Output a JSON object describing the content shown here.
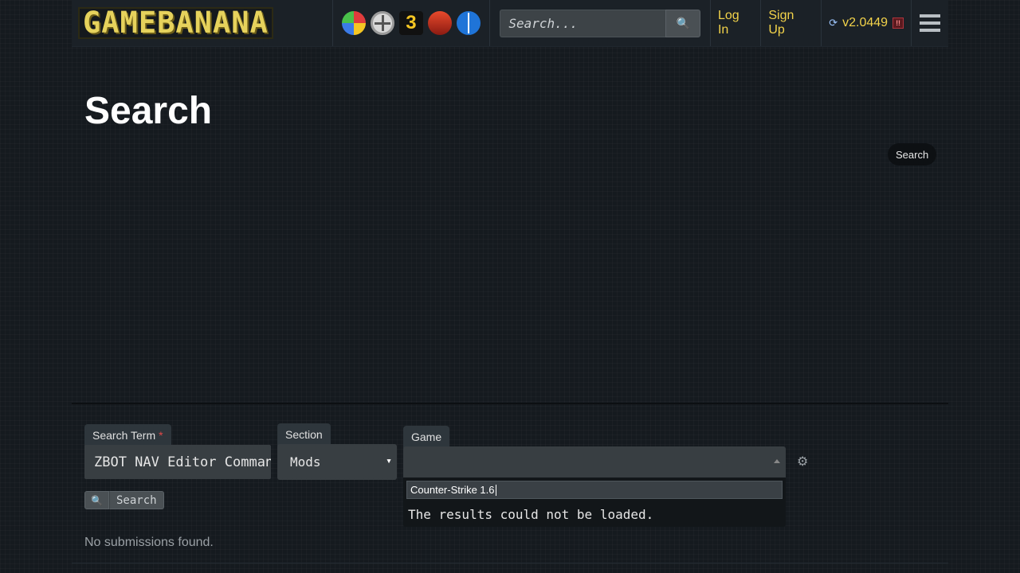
{
  "header": {
    "logo_text": "GAMEBANANA",
    "search_placeholder": "Search...",
    "login_label": "Log In",
    "signup_label": "Sign Up",
    "version": "v2.0449",
    "game_icon_3_text": "3"
  },
  "page": {
    "title": "Search",
    "pill_button_label": "Search"
  },
  "form": {
    "search_term_label": "Search Term",
    "search_term_required": "*",
    "search_term_value": "ZBOT NAV Editor Commands",
    "section_label": "Section",
    "section_value": "Mods",
    "game_label": "Game",
    "game_search_value": "Counter-Strike 1.6",
    "game_dropdown_message": "The results could not be loaded.",
    "search_button_label": "Search",
    "no_results": "No submissions found."
  },
  "icons": [
    "game-icon-1",
    "smash-icon",
    "game-icon-3",
    "game-icon-4",
    "switch-icon",
    "search-icon",
    "update-icon",
    "warning-icon",
    "menu-icon",
    "gear-icon"
  ],
  "colors": {
    "accent": "#f3d34a",
    "background": "#151a1f",
    "header": "#1b2127"
  }
}
